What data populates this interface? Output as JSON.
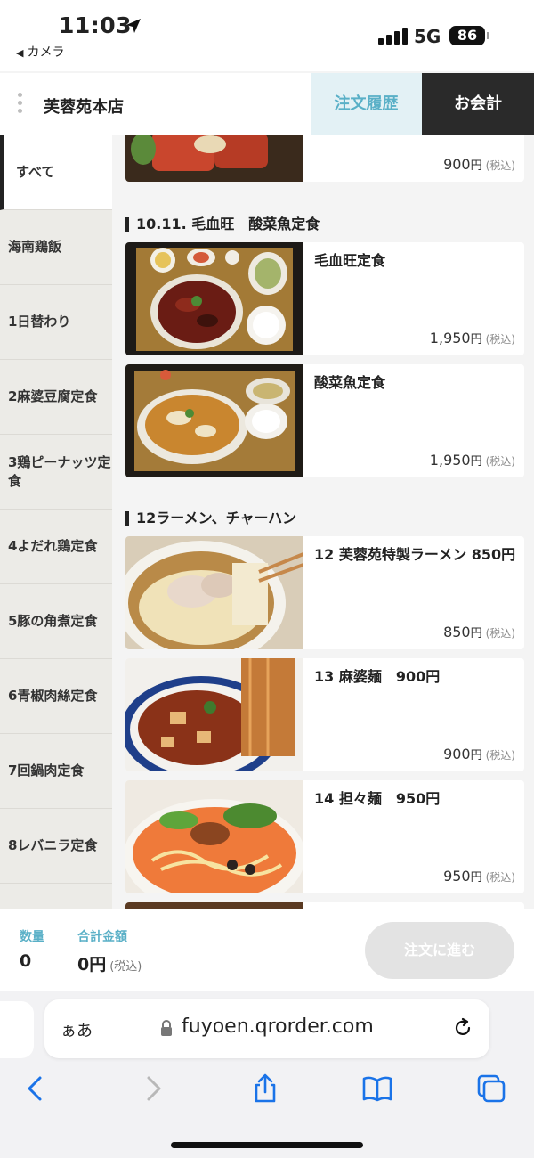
{
  "status_bar": {
    "time": "11:03",
    "back_app": "カメラ",
    "network": "5G",
    "battery": "86"
  },
  "header": {
    "store_name": "芙蓉苑本店",
    "history_label": "注文履歴",
    "checkout_label": "お会計"
  },
  "sidebar": {
    "items": [
      {
        "label": "すべて"
      },
      {
        "label": "海南鶏飯"
      },
      {
        "label": "1日替わり"
      },
      {
        "label": "2麻婆豆腐定食"
      },
      {
        "label": "3鶏ピーナッツ定食"
      },
      {
        "label": "4よだれ鶏定食"
      },
      {
        "label": "5豚の角煮定食"
      },
      {
        "label": "6青椒肉絲定食"
      },
      {
        "label": "7回鍋肉定食"
      },
      {
        "label": "8レバニラ定食"
      }
    ]
  },
  "menu": {
    "top_partial": {
      "price": "900",
      "yen": "円",
      "tax": "(税込)"
    },
    "sections": [
      {
        "title": "10.11. 毛血旺　酸菜魚定食",
        "items": [
          {
            "name": "毛血旺定食",
            "price": "1,950",
            "yen": "円",
            "tax": "(税込)"
          },
          {
            "name": "酸菜魚定食",
            "price": "1,950",
            "yen": "円",
            "tax": "(税込)"
          }
        ]
      },
      {
        "title": "12ラーメン、チャーハン",
        "items": [
          {
            "name": "12 芙蓉苑特製ラーメン 850円",
            "price": "850",
            "yen": "円",
            "tax": "(税込)"
          },
          {
            "name": "13 麻婆麺　900円",
            "price": "900",
            "yen": "円",
            "tax": "(税込)"
          },
          {
            "name": "14 担々麺　950円",
            "price": "950",
            "yen": "円",
            "tax": "(税込)"
          }
        ]
      }
    ]
  },
  "order_bar": {
    "qty_label": "数量",
    "qty_value": "0",
    "total_label": "合計金額",
    "total_value": "0円",
    "total_tax": "(税込)",
    "proceed_label": "注文に進む"
  },
  "safari": {
    "aa_label": "ぁあ",
    "url": "fuyoen.qrorder.com"
  },
  "icons": {
    "location": "location-arrow-icon",
    "signal": "cellular-signal-icon",
    "lock": "lock-icon",
    "reload": "reload-icon",
    "back": "back-chevron-icon",
    "forward": "forward-chevron-icon",
    "share": "share-icon",
    "bookmarks": "book-icon",
    "tabs": "tabs-icon"
  },
  "colors": {
    "accent": "#5ab0c7",
    "history_bg": "#e3f1f5",
    "checkout_bg": "#2a2a2a",
    "sidebar_bg": "#ecebe7"
  }
}
